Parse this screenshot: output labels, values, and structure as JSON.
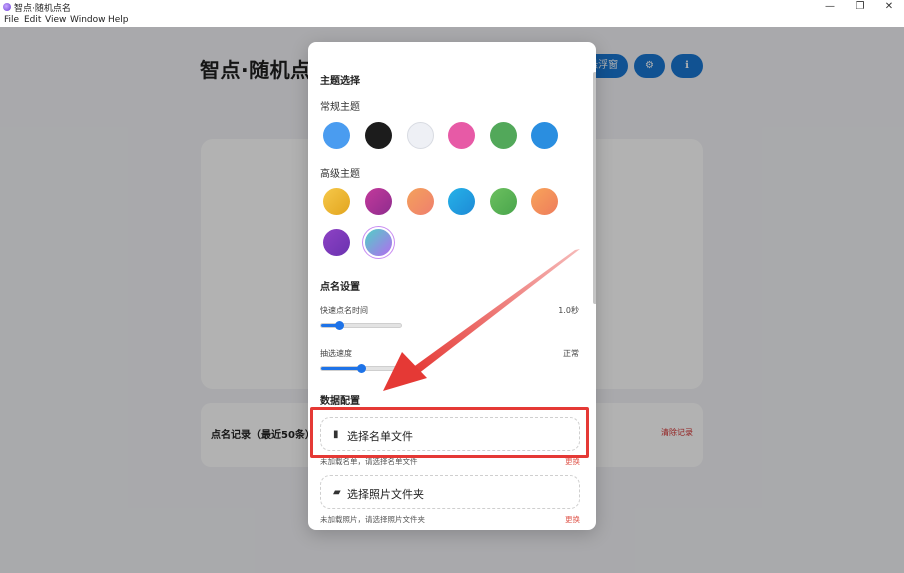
{
  "window": {
    "title": "智点·随机点名",
    "minimize": "—",
    "maximize": "❐",
    "close": "✕"
  },
  "menu": [
    "File",
    "Edit",
    "View",
    "Window",
    "Help"
  ],
  "app": {
    "title": "智点·随机点名",
    "float_button": "显示悬浮窗",
    "record_title": "点名记录（最近50条）",
    "clear_records": "清除记录"
  },
  "modal": {
    "theme_title": "主题选择",
    "normal_theme_label": "常规主题",
    "normal_colors": [
      "#4a9cf0",
      "#1c1c1c",
      "#eef0f5",
      "#e75aa6",
      "#52a85a",
      "#2a8ee0"
    ],
    "advanced_theme_label": "高级主题",
    "advanced_colors": [
      "linear-gradient(135deg,#f6c84a,#e2a51e)",
      "linear-gradient(135deg,#c33a9b,#8e2c8e)",
      "linear-gradient(135deg,#f4a15b,#ef7f6e)",
      "linear-gradient(135deg,#25b2e8,#1e8ad6)",
      "linear-gradient(135deg,#6cc05f,#49a54c)",
      "linear-gradient(135deg,#f8a45a,#ee7c5c)",
      "linear-gradient(135deg,#8e42c4,#6a32b0)",
      "linear-gradient(135deg,#4fd1c5,#b36bf0)"
    ],
    "rollcall_title": "点名设置",
    "fast_time_label": "快速点名时间",
    "fast_time_value": "1.0秒",
    "fast_time_fraction": 0.22,
    "speed_label": "抽选速度",
    "speed_value": "正常",
    "speed_fraction": 0.5,
    "data_title": "数据配置",
    "select_list_button": "选择名单文件",
    "list_hint": "未加载名单，请选择名单文件",
    "list_change": "更换",
    "select_photo_button": "选择照片文件夹",
    "photo_hint": "未加载照片，请选择照片文件夹",
    "photo_change": "更换"
  },
  "annotation_color": "#e53935"
}
